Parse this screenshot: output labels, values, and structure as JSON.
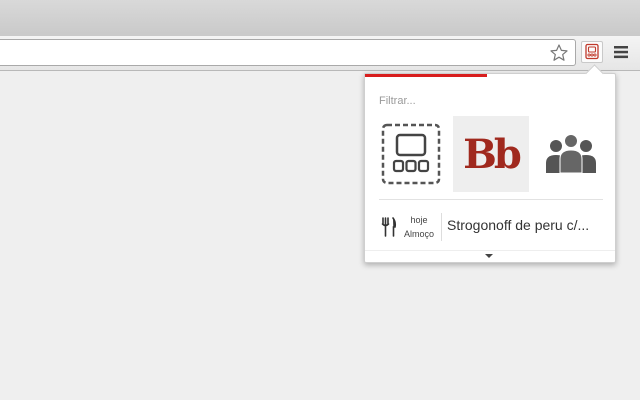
{
  "browser": {
    "toolbar": {
      "star_icon": "star-icon",
      "extension_icon": "app-launcher-icon",
      "menu_icon": "hamburger-menu-icon"
    }
  },
  "popup": {
    "accent_color": "#d81e1e",
    "filter": {
      "placeholder": "Filtrar..."
    },
    "apps": [
      {
        "icon": "app-launcher-outline-icon"
      },
      {
        "label": "Bb",
        "icon": "blackboard-logo"
      },
      {
        "icon": "people-group-icon"
      }
    ],
    "meal": {
      "icon": "fork-knife-icon",
      "day": "hoje",
      "type": "Almoço",
      "description": "Strogonoff de peru c/..."
    },
    "expand_icon": "chevron-down-icon"
  }
}
